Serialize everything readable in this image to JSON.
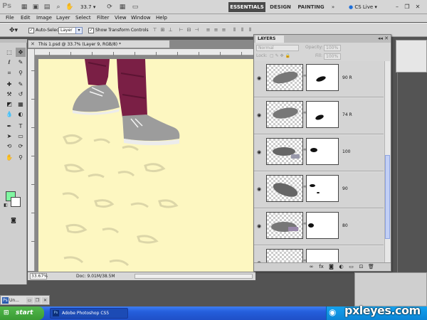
{
  "appbar": {
    "logo": "Ps",
    "zoom": "33.7",
    "workspaces": [
      "ESSENTIALS",
      "DESIGN",
      "PAINTING"
    ],
    "more": "»",
    "cs_live": "CS Live ▾"
  },
  "menu": [
    "File",
    "Edit",
    "Image",
    "Layer",
    "Select",
    "Filter",
    "View",
    "Window",
    "Help"
  ],
  "options": {
    "auto_select_label": "Auto-Select:",
    "auto_select_value": "Layer",
    "show_transform_label": "Show Transform Controls"
  },
  "document": {
    "tab_title": "This 1.psd @ 33.7% (Layer 9, RGB/8) *",
    "zoom_field": "33.67%",
    "doc_info": "Doc: 9.01M/38.5M"
  },
  "layers_panel": {
    "title": "LAYERS",
    "blend_mode": "Normal",
    "opacity_label": "Opacity:",
    "opacity_value": "100%",
    "lock_label": "Lock:",
    "fill_label": "Fill:",
    "fill_value": "100%",
    "layers": [
      {
        "name": "90 R"
      },
      {
        "name": "74 R"
      },
      {
        "name": "100"
      },
      {
        "name": "90"
      },
      {
        "name": "80"
      },
      {
        "name": ""
      }
    ],
    "footer_icons": [
      "link-icon",
      "fx-icon",
      "mask-icon",
      "adjustment-icon",
      "group-icon",
      "new-layer-icon",
      "trash-icon"
    ]
  },
  "colors": {
    "foreground": "#80f7a1",
    "background": "#ffffff",
    "canvas": "#fdf7c1"
  },
  "minimized_doc": {
    "label": "Un..."
  },
  "taskbar": {
    "start": "start",
    "task": "Adobe Photoshop CS5"
  },
  "watermark": "pxleyes.com"
}
